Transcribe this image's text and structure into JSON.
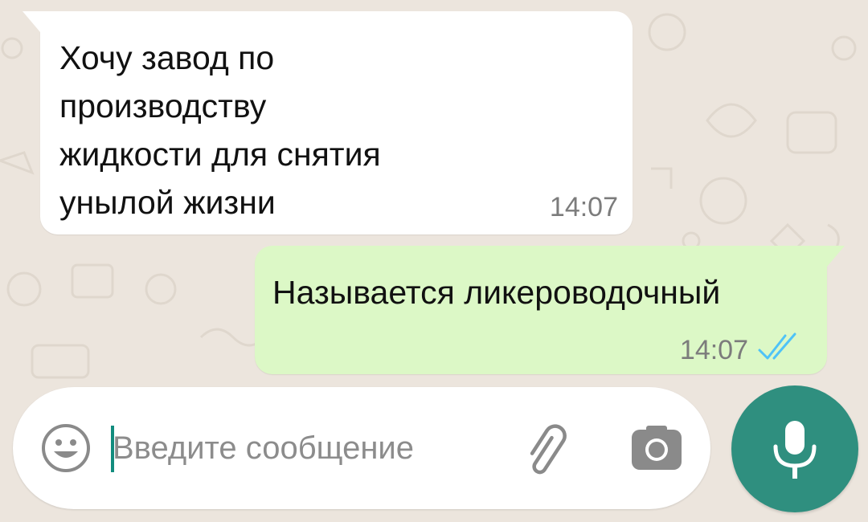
{
  "chat": {
    "messages": [
      {
        "direction": "incoming",
        "text": "Хочу завод по\nпроизводству\nжидкости для снятия\nунылой жизни",
        "time": "14:07"
      },
      {
        "direction": "outgoing",
        "text": "Называется ликероводочный",
        "time": "14:07",
        "status": "read"
      }
    ]
  },
  "composer": {
    "placeholder": "Введите сообщение",
    "value": "",
    "icons": {
      "emoji": "emoji-icon",
      "attach": "paperclip-icon",
      "camera": "camera-icon",
      "mic": "microphone-icon"
    }
  },
  "colors": {
    "wallpaper": "#ece5dd",
    "incoming_bubble": "#ffffff",
    "outgoing_bubble": "#dcf8c6",
    "read_ticks": "#4fc3f7",
    "mic_button": "#2f8f7f",
    "caret": "#128c7e"
  }
}
